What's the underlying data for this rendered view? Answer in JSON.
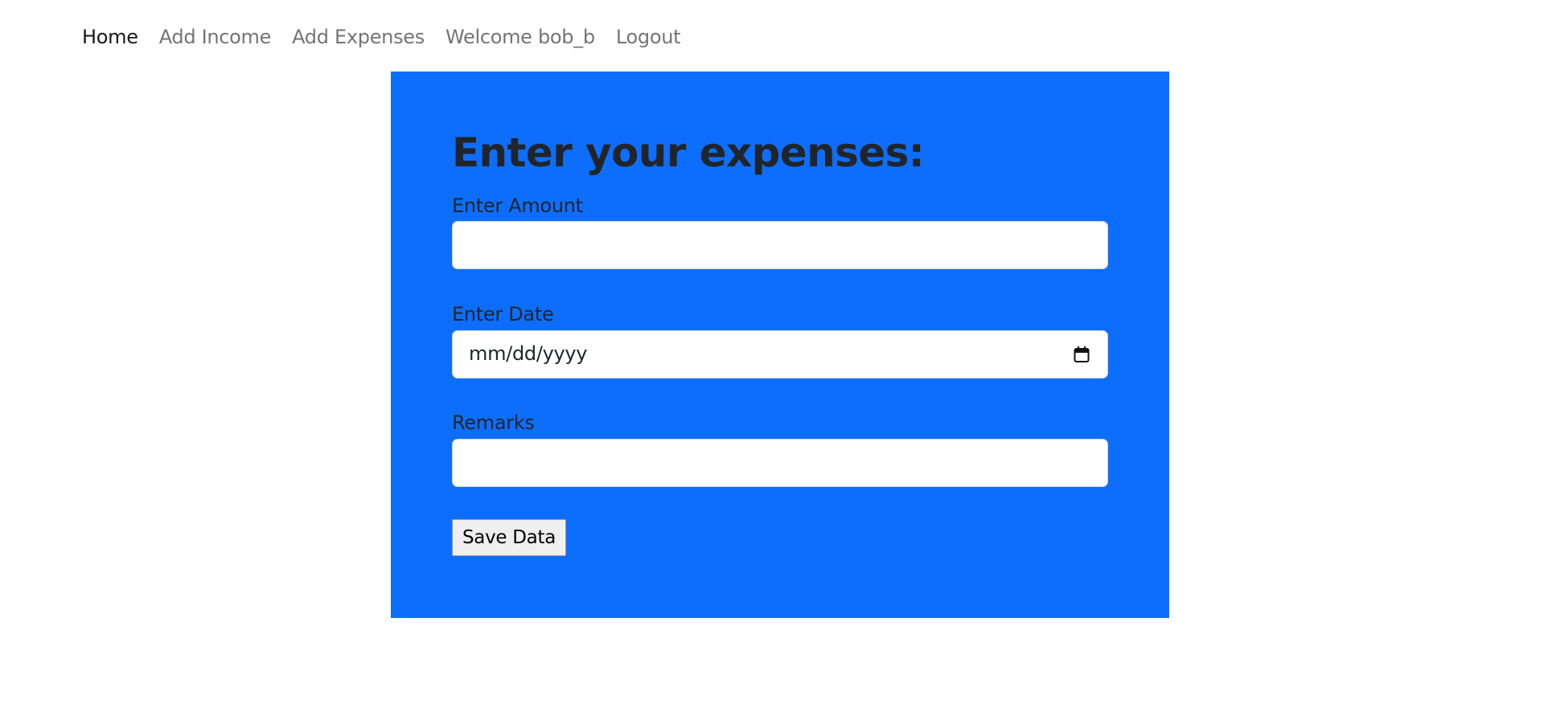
{
  "nav": {
    "items": [
      {
        "label": "Home",
        "active": true
      },
      {
        "label": "Add Income",
        "active": false
      },
      {
        "label": "Add Expenses",
        "active": false
      },
      {
        "label": "Welcome bob_b",
        "active": false
      },
      {
        "label": "Logout",
        "active": false
      }
    ]
  },
  "form": {
    "title": "Enter your expenses:",
    "amount_label": "Enter Amount",
    "amount_value": "",
    "date_label": "Enter Date",
    "date_placeholder": "mm/dd/yyyy",
    "remarks_label": "Remarks",
    "remarks_value": "",
    "save_label": "Save Data"
  },
  "colors": {
    "panel_bg": "#0d6efd",
    "text": "#212529",
    "nav_muted": "rgba(0,0,0,0.55)"
  },
  "icons": {
    "date": "calendar-icon"
  }
}
